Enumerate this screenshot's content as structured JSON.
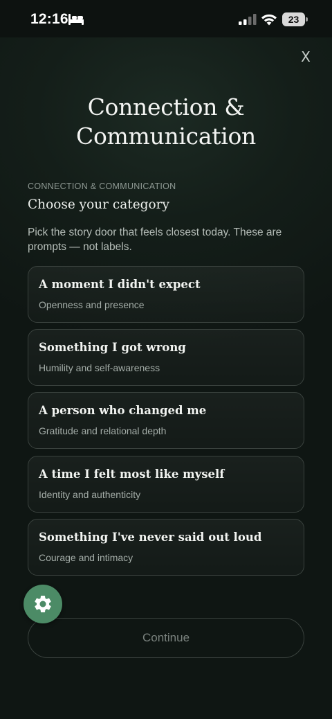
{
  "status_bar": {
    "time": "12:16",
    "battery_level": "23"
  },
  "header": {
    "close_label": "X",
    "title": "Connection & Communication"
  },
  "content": {
    "eyebrow": "CONNECTION & COMMUNICATION",
    "heading": "Choose your category",
    "description": "Pick the story door that feels closest today. These are prompts — not labels."
  },
  "categories": [
    {
      "title": "A moment I didn't expect",
      "subtitle": "Openness and presence"
    },
    {
      "title": "Something I got wrong",
      "subtitle": "Humility and self-awareness"
    },
    {
      "title": "A person who changed me",
      "subtitle": "Gratitude and relational depth"
    },
    {
      "title": "A time I felt most like myself",
      "subtitle": "Identity and authenticity"
    },
    {
      "title": "Something I've never said out loud",
      "subtitle": "Courage and intimacy"
    }
  ],
  "footer": {
    "continue_label": "Continue"
  },
  "icons": {
    "settings": "gear-icon",
    "close": "close-icon"
  },
  "colors": {
    "background": "#0e1512",
    "accent_green": "#4c8b66",
    "card_border": "#3a423e"
  }
}
